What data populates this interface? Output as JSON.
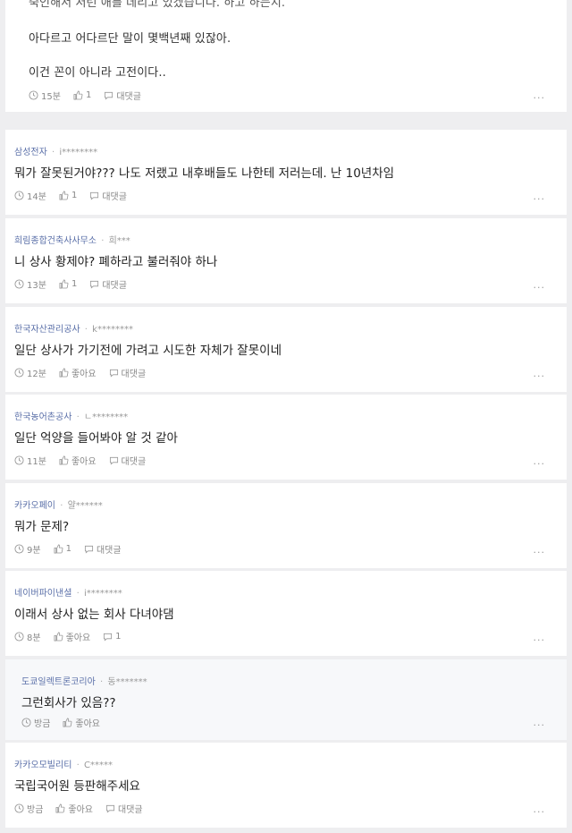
{
  "top_card": {
    "line_partial": "죽인해서 저런 애를 데리고 있겠습니다. 하고 하는지.",
    "line1": "아다르고 어다르단 말이 몇백년째 있잖아.",
    "line2": "이건 꼰이 아니라 고전이다..",
    "time": "15분",
    "likes": "1",
    "reply": "대댓글",
    "more": "..."
  },
  "comments": [
    {
      "company": "삼성전자",
      "user": "i********",
      "text": "뭐가 잘못된거야??? 나도 저랬고 내후배들도 나한테 저러는데. 난 10년차임",
      "time": "14분",
      "likes": "1",
      "reply": "대댓글",
      "more": "..."
    },
    {
      "company": "희림종합건축사사무소",
      "user": "희***",
      "text": "니 상사 황제야? 폐하라고 불러줘야 하나",
      "time": "13분",
      "likes": "1",
      "reply": "대댓글",
      "more": "..."
    },
    {
      "company": "한국자산관리공사",
      "user": "k********",
      "text": "일단 상사가 가기전에 가려고 시도한 자체가 잘못이네",
      "time": "12분",
      "likes": "좋아요",
      "reply": "대댓글",
      "more": "..."
    },
    {
      "company": "한국농어촌공사",
      "user": "ㄴ********",
      "text": "일단 억양을 들어봐야 알 것 같아",
      "time": "11분",
      "likes": "좋아요",
      "reply": "대댓글",
      "more": "..."
    },
    {
      "company": "카카오페이",
      "user": "얄******",
      "text": "뭐가 문제?",
      "time": "9분",
      "likes": "1",
      "reply": "대댓글",
      "more": "..."
    },
    {
      "company": "네이버파이낸셜",
      "user": "i********",
      "text": "이래서 상사 없는 회사 다녀야댐",
      "time": "8분",
      "likes": "좋아요",
      "reply": "1",
      "more": "..."
    },
    {
      "company": "도쿄일렉트론코리아",
      "user": "동*******",
      "text": "그런회사가 있음??",
      "time": "방금",
      "likes": "좋아요",
      "reply": "",
      "more": "..."
    },
    {
      "company": "카카오모빌리티",
      "user": "C*****",
      "text": "국립국어원 등판해주세요",
      "time": "방금",
      "likes": "좋아요",
      "reply": "대댓글",
      "more": "..."
    }
  ]
}
